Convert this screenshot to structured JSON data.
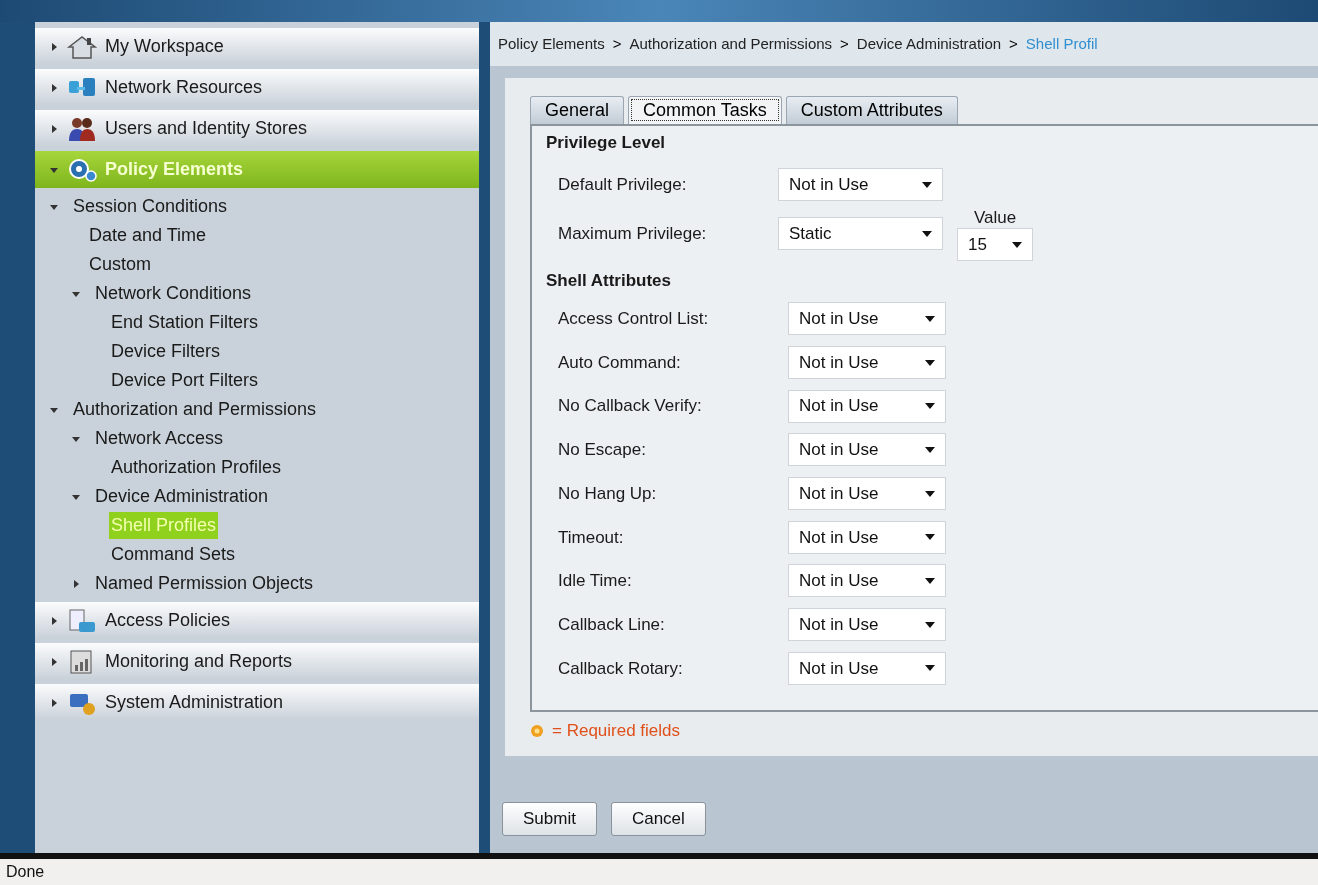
{
  "nav": [
    {
      "label": "My Workspace",
      "selected": false,
      "expanded": false
    },
    {
      "label": "Network Resources",
      "selected": false,
      "expanded": false
    },
    {
      "label": "Users and Identity Stores",
      "selected": false,
      "expanded": false
    },
    {
      "label": "Policy Elements",
      "selected": true,
      "expanded": true,
      "children": [
        {
          "label": "Session Conditions",
          "expanded": true,
          "selected": false,
          "children": [
            {
              "label": "Date and Time",
              "selected": false
            },
            {
              "label": "Custom",
              "selected": false
            },
            {
              "label": "Network Conditions",
              "expanded": true,
              "selected": false,
              "children": [
                {
                  "label": "End Station Filters",
                  "selected": false
                },
                {
                  "label": "Device Filters",
                  "selected": false
                },
                {
                  "label": "Device Port Filters",
                  "selected": false
                }
              ]
            }
          ]
        },
        {
          "label": "Authorization and Permissions",
          "expanded": true,
          "selected": false,
          "children": [
            {
              "label": "Network Access",
              "expanded": true,
              "selected": false,
              "children": [
                {
                  "label": "Authorization Profiles",
                  "selected": false
                }
              ]
            },
            {
              "label": "Device Administration",
              "expanded": true,
              "selected": false,
              "children": [
                {
                  "label": "Shell Profiles",
                  "selected": true
                },
                {
                  "label": "Command Sets",
                  "selected": false
                }
              ]
            },
            {
              "label": "Named Permission Objects",
              "expanded": false,
              "selected": false
            }
          ]
        }
      ]
    },
    {
      "label": "Access Policies",
      "selected": false,
      "expanded": false
    },
    {
      "label": "Monitoring and Reports",
      "selected": false,
      "expanded": false
    },
    {
      "label": "System Administration",
      "selected": false,
      "expanded": false
    }
  ],
  "breadcrumb": {
    "separator": ">",
    "items": [
      {
        "label": "Policy Elements",
        "current": false
      },
      {
        "label": "Authorization and Permissions",
        "current": false
      },
      {
        "label": "Device Administration",
        "current": false
      },
      {
        "label": "Shell Profil",
        "current": true
      }
    ]
  },
  "tabs": [
    {
      "label": "General",
      "selected": false
    },
    {
      "label": "Common Tasks",
      "selected": true
    },
    {
      "label": "Custom Attributes",
      "selected": false
    }
  ],
  "privilege": {
    "heading": "Privilege Level",
    "default": {
      "label": "Default Privilege:",
      "value": "Not in Use"
    },
    "maximum": {
      "label": "Maximum Privilege:",
      "value": "Static",
      "value_label": "Value",
      "value_select": "15"
    }
  },
  "shell": {
    "heading": "Shell Attributes",
    "rows": [
      {
        "label": "Access Control List:",
        "value": "Not in Use"
      },
      {
        "label": "Auto Command:",
        "value": "Not in Use"
      },
      {
        "label": "No Callback Verify:",
        "value": "Not in Use"
      },
      {
        "label": "No Escape:",
        "value": "Not in Use"
      },
      {
        "label": "No Hang Up:",
        "value": "Not in Use"
      },
      {
        "label": "Timeout:",
        "value": "Not in Use"
      },
      {
        "label": "Idle Time:",
        "value": "Not in Use"
      },
      {
        "label": "Callback Line:",
        "value": "Not in Use"
      },
      {
        "label": "Callback Rotary:",
        "value": "Not in Use"
      }
    ]
  },
  "required_note": "= Required fields",
  "buttons": [
    "Submit",
    "Cancel"
  ],
  "status_bar": "Done"
}
